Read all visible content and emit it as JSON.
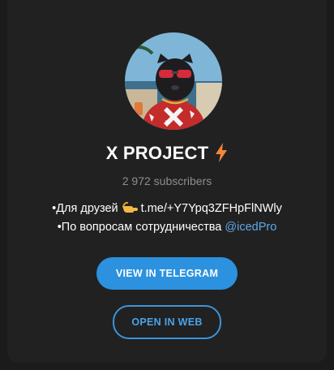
{
  "channel": {
    "title": "X PROJECT",
    "title_icon": "lightning-bolt-icon",
    "subscribers": "2 972 subscribers",
    "description": {
      "line1_prefix": "•Для друзей",
      "line1_emoji": "pointing-hand-icon",
      "line1_link": "t.me/+Y7Ypq3ZFHpFlNWly",
      "line2_text": "•По вопросам сотрудничества",
      "line2_mention": "@icedPro"
    }
  },
  "buttons": {
    "view_in_telegram": "VIEW IN TELEGRAM",
    "open_in_web": "OPEN IN WEB"
  },
  "colors": {
    "page_background": "#1b1b1b",
    "card_background": "#212121",
    "primary_button": "#2c91df",
    "link": "#5fa8e8",
    "muted_text": "#8e8e8e"
  }
}
